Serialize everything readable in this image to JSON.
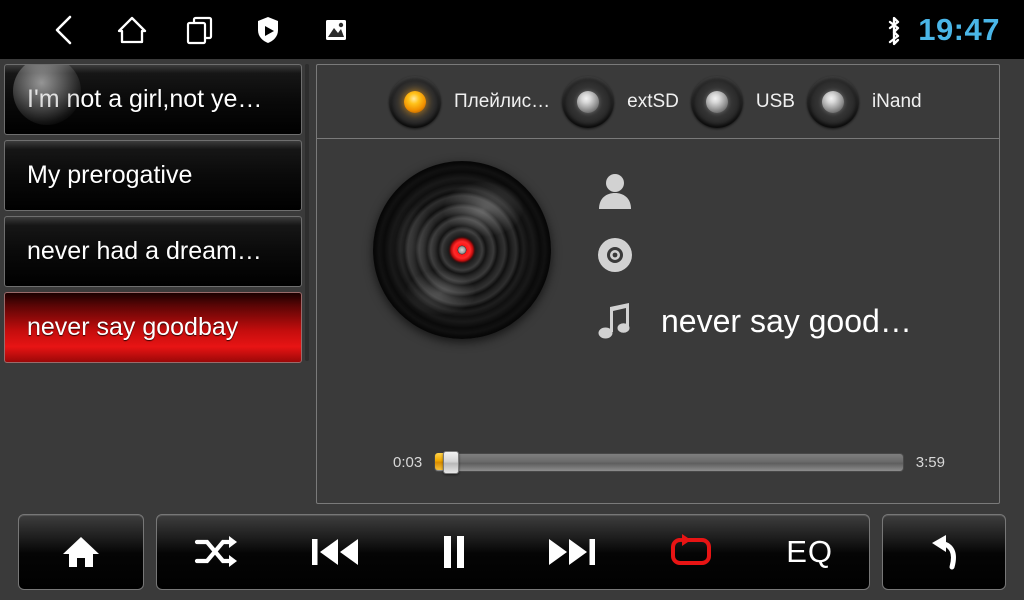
{
  "statusbar": {
    "nav_icons": [
      {
        "name": "back-icon",
        "label": "Back"
      },
      {
        "name": "home-icon",
        "label": "Home"
      },
      {
        "name": "recents-icon",
        "label": "Recent apps"
      },
      {
        "name": "shield-play-icon",
        "label": "Protected media"
      },
      {
        "name": "gallery-icon",
        "label": "Gallery"
      }
    ],
    "bluetooth_icon": "bluetooth-icon",
    "time": "19:47",
    "time_color": "#4ab6e8"
  },
  "playlist": {
    "items": [
      {
        "title": "I'm not a girl,not ye…",
        "selected": false,
        "ripple": true
      },
      {
        "title": "My prerogative",
        "selected": false,
        "ripple": false
      },
      {
        "title": "never had a dream…",
        "selected": false,
        "ripple": false
      },
      {
        "title": "never say goodbay",
        "selected": true,
        "ripple": false
      }
    ],
    "selected_color": "#e81414"
  },
  "sources": {
    "tabs": [
      {
        "label": "Плейлис…",
        "active": true
      },
      {
        "label": "extSD",
        "active": false
      },
      {
        "label": "USB",
        "active": false
      },
      {
        "label": "iNand",
        "active": false
      }
    ],
    "active_led_color": "#ffc21a"
  },
  "now_playing": {
    "album_art_icon": "vinyl-disc-icon",
    "meta": [
      {
        "icon": "person-icon",
        "field": "artist",
        "value": ""
      },
      {
        "icon": "disc-icon",
        "field": "album",
        "value": ""
      },
      {
        "icon": "music-note-icon",
        "field": "title",
        "value": "never say good…"
      }
    ],
    "progress": {
      "elapsed": "0:03",
      "duration": "3:59",
      "percent": 1.3,
      "fill_color": "#f0a800"
    }
  },
  "controls": {
    "home": {
      "icon": "home-filled-icon",
      "label": "Home"
    },
    "shuffle": {
      "icon": "shuffle-icon",
      "label": "Shuffle",
      "active": false
    },
    "previous": {
      "icon": "previous-track-icon",
      "label": "Previous"
    },
    "pause": {
      "icon": "pause-icon",
      "label": "Pause"
    },
    "next": {
      "icon": "next-track-icon",
      "label": "Next"
    },
    "repeat": {
      "icon": "repeat-icon",
      "label": "Repeat",
      "active": true,
      "color": "#e81414"
    },
    "eq": {
      "icon": "eq-label",
      "label": "EQ"
    },
    "back": {
      "icon": "return-arrow-icon",
      "label": "Back"
    }
  }
}
